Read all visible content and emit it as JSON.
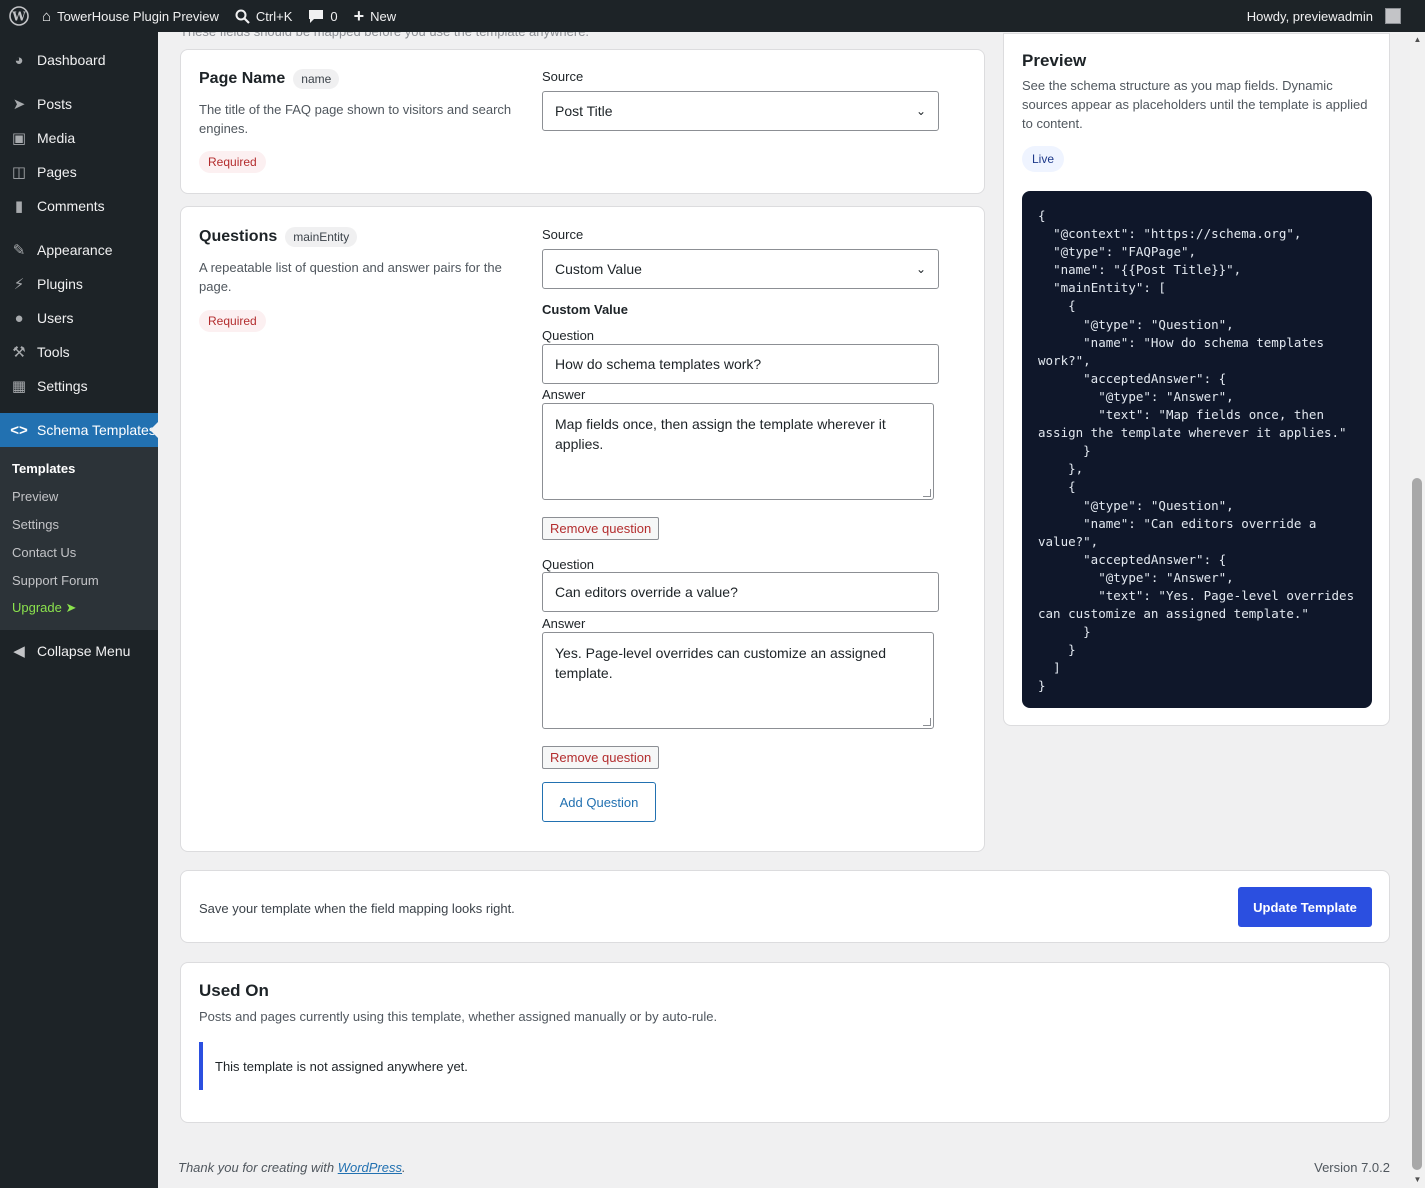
{
  "adminbar": {
    "site_name": "TowerHouse Plugin Preview",
    "shortcut": "Ctrl+K",
    "comments_count": "0",
    "new_label": "New",
    "howdy": "Howdy, previewadmin"
  },
  "menu": {
    "items": {
      "dashboard": "Dashboard",
      "posts": "Posts",
      "media": "Media",
      "pages": "Pages",
      "comments": "Comments",
      "appearance": "Appearance",
      "plugins": "Plugins",
      "users": "Users",
      "tools": "Tools",
      "settings": "Settings",
      "schema": "Schema Templates",
      "collapse": "Collapse Menu"
    },
    "submenu": {
      "templates": "Templates",
      "preview": "Preview",
      "settings": "Settings",
      "contact": "Contact Us",
      "support": "Support Forum",
      "upgrade": "Upgrade ➤"
    }
  },
  "top_cut_text": "These fields should be mapped before you use the template anywhere.",
  "page_name": {
    "title": "Page Name",
    "prop": "name",
    "description": "The title of the FAQ page shown to visitors and search engines.",
    "required": "Required",
    "source_label": "Source",
    "source_value": "Post Title"
  },
  "questions": {
    "title": "Questions",
    "prop": "mainEntity",
    "description": "A repeatable list of question and answer pairs for the page.",
    "required": "Required",
    "source_label": "Source",
    "source_value": "Custom Value",
    "custom_value_label": "Custom Value",
    "question_label": "Question",
    "answer_label": "Answer",
    "remove_label": "Remove question",
    "add_label": "Add Question",
    "items": [
      {
        "question": "How do schema templates work?",
        "answer": "Map fields once, then assign the template wherever it applies."
      },
      {
        "question": "Can editors override a value?",
        "answer": "Yes. Page-level overrides can customize an assigned template."
      }
    ]
  },
  "preview": {
    "title": "Preview",
    "description": "See the schema structure as you map fields. Dynamic sources appear as placeholders until the template is applied to content.",
    "badge": "Live",
    "code": "{\n  \"@context\": \"https://schema.org\",\n  \"@type\": \"FAQPage\",\n  \"name\": \"{{Post Title}}\",\n  \"mainEntity\": [\n    {\n      \"@type\": \"Question\",\n      \"name\": \"How do schema templates work?\",\n      \"acceptedAnswer\": {\n        \"@type\": \"Answer\",\n        \"text\": \"Map fields once, then assign the template wherever it applies.\"\n      }\n    },\n    {\n      \"@type\": \"Question\",\n      \"name\": \"Can editors override a value?\",\n      \"acceptedAnswer\": {\n        \"@type\": \"Answer\",\n        \"text\": \"Yes. Page-level overrides can customize an assigned template.\"\n      }\n    }\n  ]\n}"
  },
  "save_bar": {
    "text": "Save your template when the field mapping looks right.",
    "button": "Update Template"
  },
  "used_on": {
    "title": "Used On",
    "description": "Posts and pages currently using this template, whether assigned manually or by auto-rule.",
    "notice": "This template is not assigned anywhere yet."
  },
  "footer": {
    "thanks": "Thank you for creating with ",
    "link": "WordPress",
    "version": "Version 7.0.2"
  }
}
